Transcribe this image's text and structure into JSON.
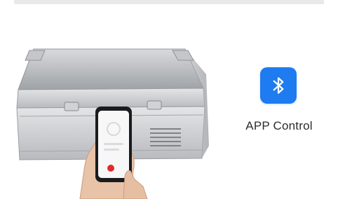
{
  "feature": {
    "label": "APP Control",
    "icon": "bluetooth-icon",
    "accent_color": "#1e7bf0"
  }
}
